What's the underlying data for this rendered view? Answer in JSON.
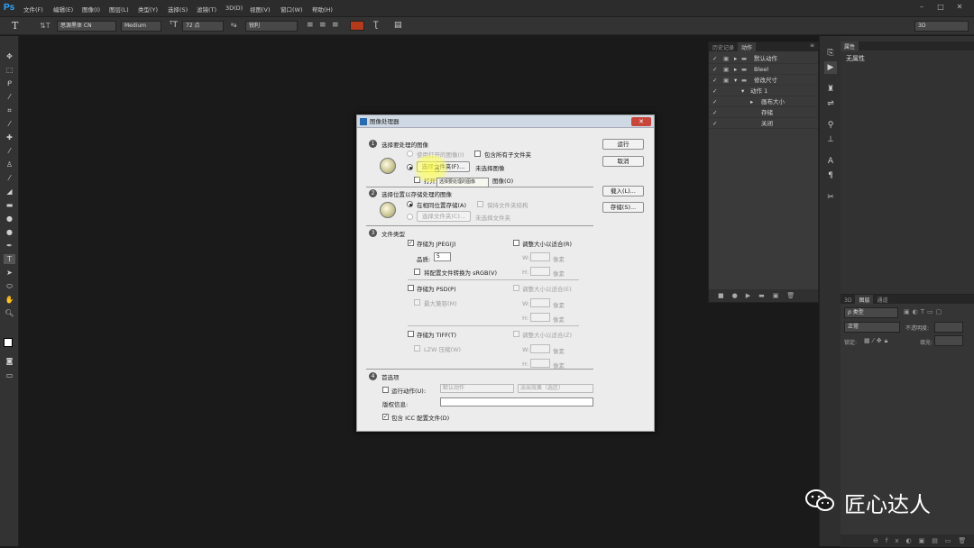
{
  "app": {
    "logo": "Ps"
  },
  "menu": [
    "文件(F)",
    "编辑(E)",
    "图像(I)",
    "图层(L)",
    "类型(Y)",
    "选择(S)",
    "滤镜(T)",
    "3D(D)",
    "视图(V)",
    "窗口(W)",
    "帮助(H)"
  ],
  "options": {
    "tool_glyph": "T",
    "font_family": "思源黑体 CN",
    "font_style": "Medium",
    "font_size": "72 点",
    "aa_label": "ªa",
    "aa_mode": "锐利",
    "workspace": "3D"
  },
  "actions_panel": {
    "tabs": [
      "历史记录",
      "动作"
    ],
    "rows": [
      {
        "label": "默认动作",
        "indent": 0
      },
      {
        "label": "Bleel",
        "indent": 0
      },
      {
        "label": "修改尺寸",
        "indent": 0
      },
      {
        "label": "动作 1",
        "indent": 1
      },
      {
        "label": "画布大小",
        "indent": 2
      },
      {
        "label": "存储",
        "indent": 3
      },
      {
        "label": "关闭",
        "indent": 3
      }
    ]
  },
  "properties_panel": {
    "tab": "属性",
    "content": "无属性"
  },
  "layers_panel": {
    "tabs": [
      "3D",
      "图层",
      "通道"
    ],
    "kind_label": "ρ 类型",
    "blend_mode": "正常",
    "opacity_label": "不透明度:",
    "lock_label": "锁定:",
    "fill_label": "填充:"
  },
  "dialog": {
    "title": "图像处理器",
    "run": "运行",
    "cancel": "取消",
    "load": "载入(L)...",
    "save": "存储(S)...",
    "s1": {
      "num": "1",
      "title": "选择要处理的图像",
      "use_open": "使用打开的图像(I)",
      "include_sub": "包含所有子文件夹",
      "select_folder": "选择文件夹(F)...",
      "no_image": "未选择图像",
      "open_first": "打开第",
      "open_first_tail": "图像(O)",
      "tooltip": "选择要处理的图像"
    },
    "s2": {
      "num": "2",
      "title": "选择位置以存储处理的图像",
      "same_location": "在相同位置存储(A)",
      "keep_structure": "保持文件夹结构",
      "select_folder": "选择文件夹(C)...",
      "no_folder": "未选择文件夹"
    },
    "s3": {
      "num": "3",
      "title": "文件类型",
      "jpeg": "存储为 JPEG(J)",
      "resize_jpeg": "调整大小以适合(R)",
      "quality_label": "品质:",
      "quality": "5",
      "w": "W:",
      "h": "H:",
      "px": "像素",
      "srgb": "将配置文件转换为 sRGB(V)",
      "psd": "存储为 PSD(P)",
      "resize_psd": "调整大小以适合(E)",
      "max_compat": "最大兼容(M)",
      "tiff": "存储为 TIFF(T)",
      "resize_tiff": "调整大小以适合(Z)",
      "lzw": "LZW 压缩(W)"
    },
    "s4": {
      "num": "4",
      "title": "首选项",
      "run_action": "运行动作(U):",
      "action_set": "默认动作",
      "action_name": "淡出效果（选区）",
      "copyright": "版权信息:",
      "icc": "包含 ICC 配置文件(D)"
    }
  },
  "watermark": "匠心达人"
}
